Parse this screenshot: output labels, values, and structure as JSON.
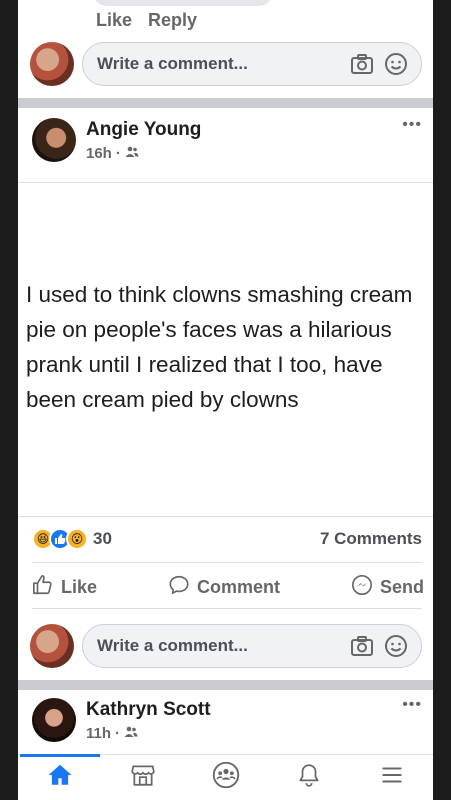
{
  "prev_comment": {
    "like_label": "Like",
    "reply_label": "Reply"
  },
  "comment_bar": {
    "placeholder": "Write a comment..."
  },
  "post": {
    "author": "Angie Young",
    "time": "16h",
    "privacy_icon": "friends-icon",
    "text": "I used to think clowns smashing cream pie on people's faces was a hilarious prank until I realized that I too, have been cream pied by clowns",
    "reactions": {
      "icons": [
        "haha-icon",
        "like-icon",
        "wow-icon"
      ],
      "count": "30"
    },
    "comments_count": "7 Comments",
    "actions": {
      "like": "Like",
      "comment": "Comment",
      "send": "Send"
    }
  },
  "next_post": {
    "author": "Kathryn Scott",
    "time": "11h"
  },
  "bottom_nav": {
    "items": [
      "home-icon",
      "marketplace-icon",
      "groups-icon",
      "notifications-icon",
      "menu-icon"
    ]
  },
  "colors": {
    "accent": "#1877f2",
    "muted": "#65676b",
    "separator": "#c9ccd1"
  }
}
